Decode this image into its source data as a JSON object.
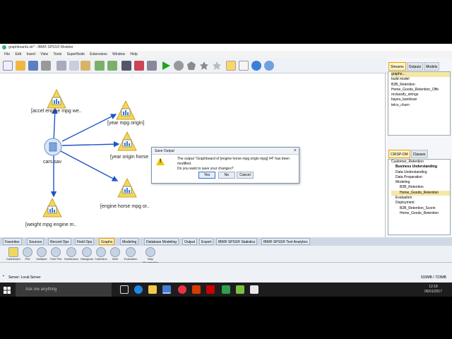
{
  "window": {
    "title": "graphboards.str* - IBM® SPSS® Modeler"
  },
  "menu": [
    "File",
    "Edit",
    "Insert",
    "View",
    "Tools",
    "SuperNode",
    "Extensions",
    "Window",
    "Help"
  ],
  "toolbar_icons": [
    "new-stream-icon",
    "open-icon",
    "save-icon",
    "print-icon",
    "cut-icon",
    "copy-icon",
    "paste-icon",
    "undo-icon",
    "redo-icon",
    "find-icon",
    "edit-icon",
    "zoom-icon",
    "run-icon",
    "stop-icon",
    "pentagon-icon",
    "star-icon",
    "star-outline-icon",
    "annotation-icon",
    "comment-icon",
    "globe-icon",
    "layout-icon"
  ],
  "canvas": {
    "source_node": "cars.sav",
    "nodes": [
      "[accel engine mpg we..",
      "[year mpg origin]",
      "[year origin horse",
      "[engine horse mpg or..",
      "[weight mpg engine m.."
    ]
  },
  "right_panel": {
    "top_tabs": [
      "Streams",
      "Outputs",
      "Models"
    ],
    "streams": [
      "grapho...",
      "build model",
      "B2B_Retention",
      "Home_Goods_Retention_Offe",
      "reclassify_strings",
      "bayes_bankloan",
      "telco_churn"
    ],
    "bottom_tabs": [
      "CRISP-DM",
      "Classes"
    ],
    "crisp": [
      "Customer_Retention",
      "Business Understanding",
      "Data Understanding",
      "Data Preparation",
      "Modeling",
      "B2B_Retention",
      "Home_Goods_Retention",
      "Evaluation",
      "Deployment",
      "B2B_Retention_Scorin",
      "Home_Goods_Retention"
    ]
  },
  "palette_tabs": [
    "Favorites",
    "Sources",
    "Record Ops",
    "Field Ops",
    "Graphs",
    "Modeling",
    "Database Modeling",
    "Output",
    "Export",
    "IBM® SPSS® Statistics",
    "IBM® SPSS® Text Analytics"
  ],
  "palette_active": "Graphs",
  "palette_items": [
    "Dashboard",
    "Plot",
    "Multiplot",
    "Time Plot",
    "Distribution",
    "Histogram",
    "Collection",
    "Web",
    "Evaluation",
    "Map Visualization"
  ],
  "status": {
    "server": "Server: Local Server",
    "memory": "533MB / 723MB"
  },
  "dialog": {
    "title": "Save Output",
    "message": "The output \"Graphboard of [engine horse mpg origin mpg] #4\" has been modified.",
    "question": "Do you want to save your changes?",
    "yes": "Yes",
    "no": "No",
    "cancel": "Cancel"
  },
  "taskbar": {
    "search_placeholder": "Ask me anything",
    "time": "12:18",
    "date": "06/01/2017"
  },
  "colors": {
    "accent": "#e6a000",
    "link": "#1f55c6"
  }
}
